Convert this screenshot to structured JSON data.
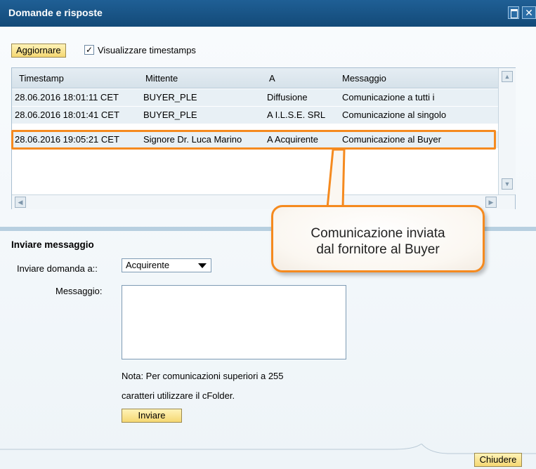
{
  "window": {
    "title": "Domande e risposte",
    "close_glyph": "✕"
  },
  "toolbar": {
    "refresh_label": "Aggiornare",
    "timestamps_checked": true,
    "timestamps_check_glyph": "✓",
    "timestamps_label": "Visualizzare timestamps"
  },
  "table": {
    "columns": [
      "Timestamp",
      "Mittente",
      "A",
      "Messaggio"
    ],
    "rows": [
      {
        "timestamp": "28.06.2016 18:01:11 CET",
        "sender": "BUYER_PLE",
        "to": "Diffusione",
        "message": "Comunicazione a tutti i"
      },
      {
        "timestamp": "28.06.2016 18:01:41 CET",
        "sender": "BUYER_PLE",
        "to": "A I.L.S.E. SRL",
        "message": "Comunicazione al singolo"
      },
      {
        "timestamp": "28.06.2016 19:05:21 CET",
        "sender": "Signore Dr. Luca Marino",
        "to": "A Acquirente",
        "message": "Comunicazione al Buyer"
      }
    ]
  },
  "callout": {
    "line1": "Comunicazione inviata",
    "line2": "dal fornitore al Buyer",
    "border_color": "#f58a1f"
  },
  "send_section": {
    "title": "Inviare messaggio",
    "recipient_label": "Inviare domanda a::",
    "recipient_value": "Acquirente",
    "message_label": "Messaggio:",
    "message_value": "",
    "note_line1": "Nota: Per comunicazioni superiori a 255",
    "note_line2": "caratteri utilizzare il cFolder.",
    "send_label": "Inviare"
  },
  "footer": {
    "close_label": "Chiudere"
  }
}
